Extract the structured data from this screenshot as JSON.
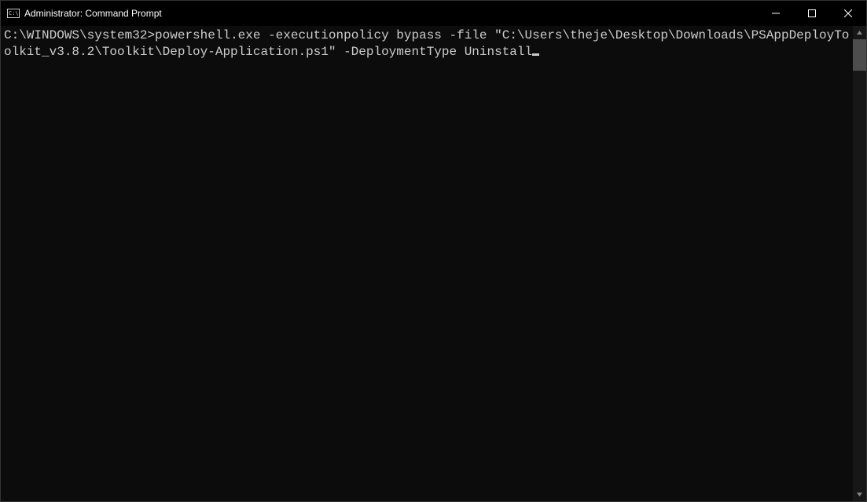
{
  "titlebar": {
    "title": "Administrator: Command Prompt"
  },
  "terminal": {
    "prompt_path": "C:\\WINDOWS\\system32",
    "prompt_separator": ">",
    "command": "powershell.exe -executionpolicy bypass -file \"C:\\Users\\theje\\Desktop\\Downloads\\PSAppDeployToolkit_v3.8.2\\Toolkit\\Deploy-Application.ps1\" -DeploymentType Uninstall"
  }
}
